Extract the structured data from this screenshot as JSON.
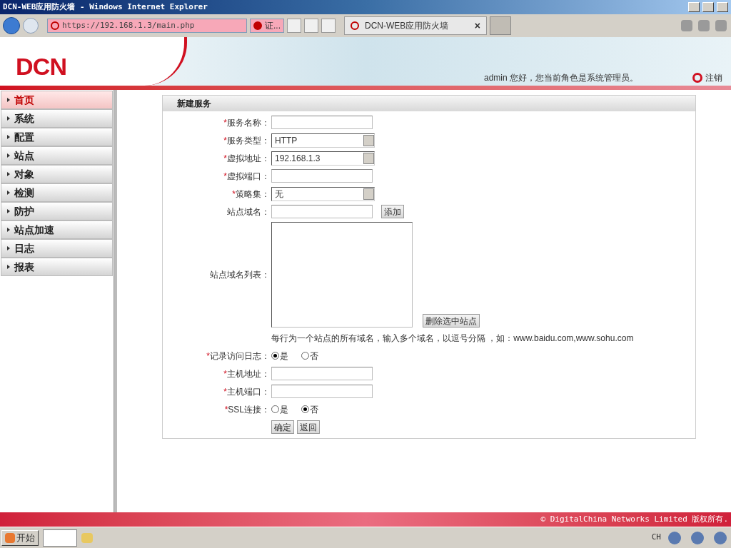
{
  "browser": {
    "title": "DCN-WEB应用防火墙 - Windows Internet Explorer",
    "address": "https://192.168.1.3/main.php",
    "security": "证...",
    "tab_title": "DCN-WEB应用防火墙",
    "tab_close": "×"
  },
  "header": {
    "logo": "DCN",
    "greeting": "admin 您好，您当前角色是系统管理员。",
    "logout": "注销"
  },
  "sidebar": {
    "items": [
      {
        "label": "首页",
        "selected": true
      },
      {
        "label": "系统",
        "selected": false
      },
      {
        "label": "配置",
        "selected": false
      },
      {
        "label": "站点",
        "selected": false
      },
      {
        "label": "对象",
        "selected": false
      },
      {
        "label": "检测",
        "selected": false
      },
      {
        "label": "防护",
        "selected": false
      },
      {
        "label": "站点加速",
        "selected": false
      },
      {
        "label": "日志",
        "selected": false
      },
      {
        "label": "报表",
        "selected": false
      }
    ]
  },
  "form": {
    "title": "新建服务",
    "fields": [
      {
        "kind": "text",
        "mark": "*",
        "label": "服务名称："
      },
      {
        "kind": "select",
        "mark": "*",
        "label": "服务类型：",
        "value": "HTTP"
      },
      {
        "kind": "select",
        "mark": "*",
        "label": "虚拟地址：",
        "value": "192.168.1.3"
      },
      {
        "kind": "text",
        "mark": "*",
        "label": "虚拟端口："
      },
      {
        "kind": "select",
        "mark": "*",
        "label": "策略集：",
        "value": "无"
      },
      {
        "kind": "text",
        "label": "站点域名：",
        "button": "添加"
      },
      {
        "kind": "textarea",
        "label": "站点域名列表：",
        "button": "删除选中站点"
      },
      {
        "kind": "hint",
        "text": "每行为一个站点的所有域名，输入多个域名，以逗号分隔 ，如：www.baidu.com,www.sohu.com"
      },
      {
        "kind": "radio",
        "mark": "*",
        "label": "记录访问日志：",
        "options": [
          {
            "label": "是",
            "selected": true
          },
          {
            "label": "否",
            "selected": false
          }
        ]
      },
      {
        "kind": "text",
        "mark": "*",
        "label": "主机地址："
      },
      {
        "kind": "text",
        "mark": "*",
        "label": "主机端口："
      },
      {
        "kind": "radio",
        "mark": "*",
        "label": "SSL连接：",
        "options": [
          {
            "label": "是",
            "selected": false
          },
          {
            "label": "否",
            "selected": true
          }
        ]
      },
      {
        "kind": "buttons",
        "buttons": [
          "确定",
          "返回"
        ]
      }
    ]
  },
  "footer": {
    "copyright": "© DigitalChina Networks Limited 版权所有."
  },
  "taskbar": {
    "start": "开始",
    "language": "CH"
  }
}
